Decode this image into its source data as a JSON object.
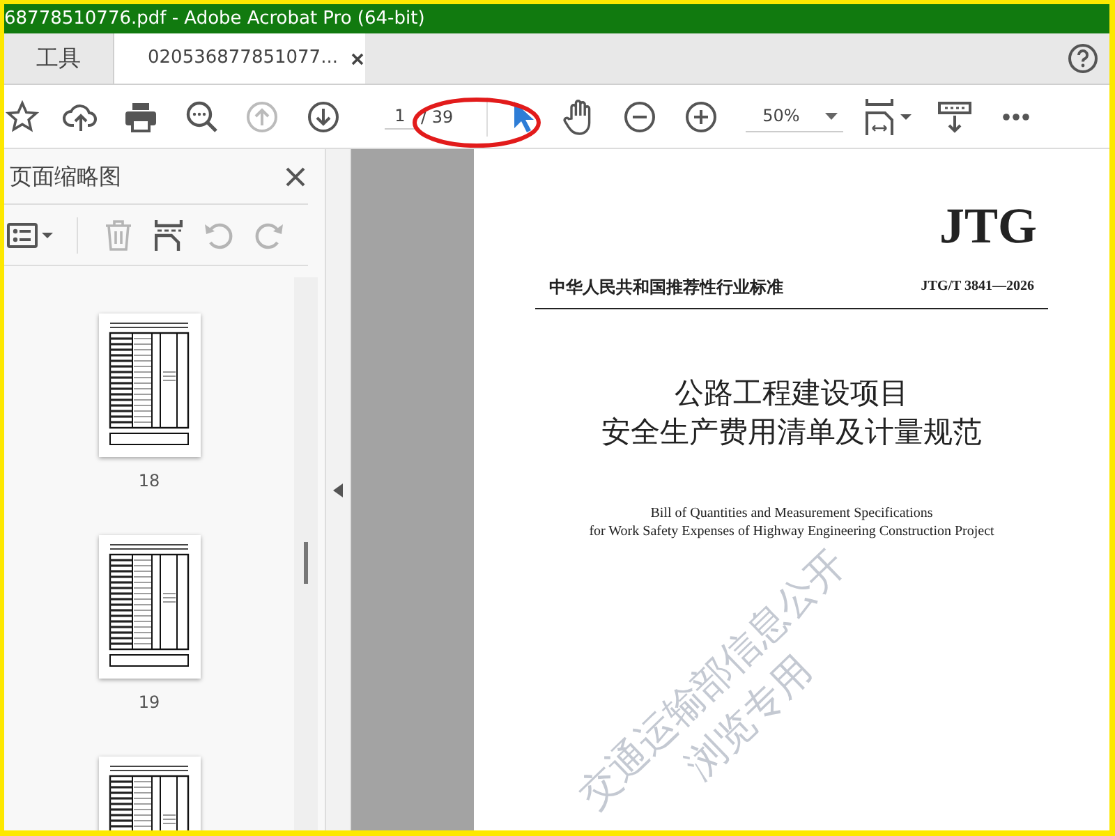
{
  "window": {
    "title": "68778510776.pdf - Adobe Acrobat Pro (64-bit)"
  },
  "tabs": [
    {
      "label": "工具",
      "selected": false,
      "closable": false
    },
    {
      "label": "020536877851077...",
      "selected": true,
      "closable": true
    }
  ],
  "toolbar": {
    "previous_page_disabled": true,
    "page_field": {
      "value": "1"
    },
    "page_total": "/ 39",
    "zoom": "50%"
  },
  "thumbnail_panel": {
    "title": "页面缩略图",
    "delete_disabled": true,
    "rotate_disabled": true,
    "thumbnails": [
      {
        "label": "18"
      },
      {
        "label": "19"
      }
    ]
  },
  "document": {
    "logo": "JTG",
    "category": "中华人民共和国推荐性行业标准",
    "code": "JTG/T 3841—2026",
    "title_lines": [
      "公路工程建设项目",
      "安全生产费用清单及计量规范"
    ],
    "english_lines": [
      "Bill of Quantities and Measurement Specifications",
      "for Work Safety Expenses of Highway Engineering Construction Project"
    ],
    "watermark_lines": [
      "交通运输部信息公开",
      "浏览专用"
    ]
  }
}
